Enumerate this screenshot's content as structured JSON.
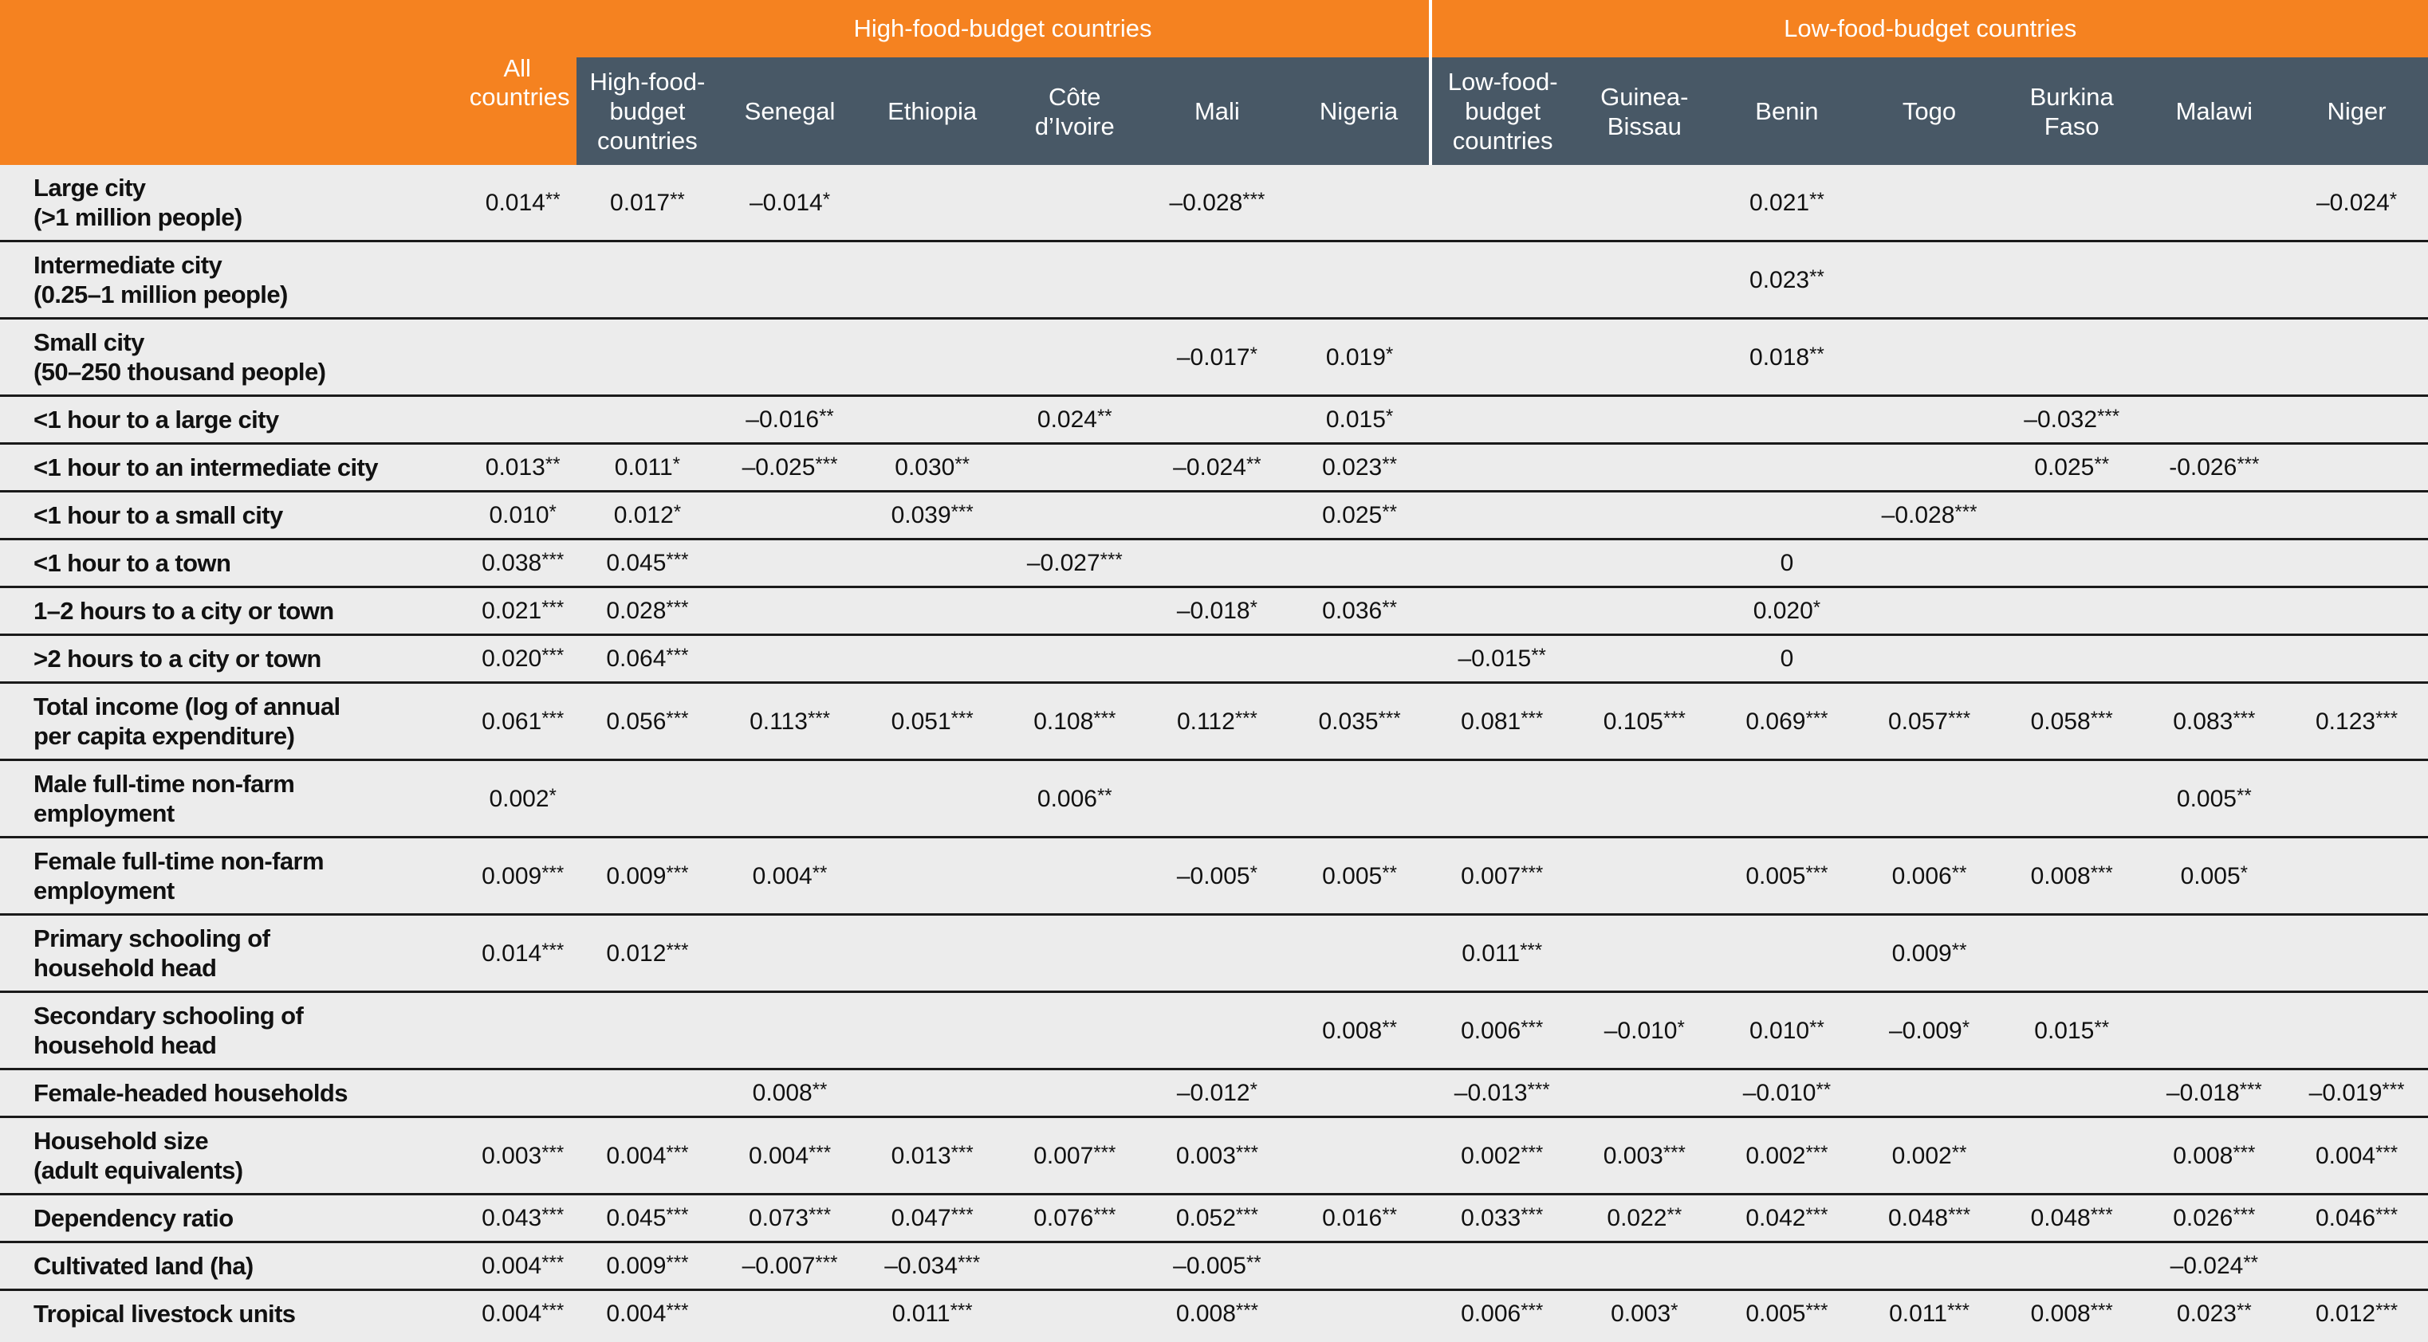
{
  "colors": {
    "orange_band": "#f58220",
    "header_dark": "#485866",
    "body_bg": "#ececec",
    "rule": "#1a1a1a"
  },
  "header": {
    "group_high": "High-food-budget countries",
    "group_low": "Low-food-budget countries",
    "all_countries": "All countries",
    "columns": [
      "High-food-budget countries",
      "Senegal",
      "Ethiopia",
      "Côte d’Ivoire",
      "Mali",
      "Nigeria",
      "Low-food-budget countries",
      "Guinea-Bissau",
      "Benin",
      "Togo",
      "Burkina Faso",
      "Malawi",
      "Niger"
    ]
  },
  "rows": [
    {
      "label": "Large city (>1 million people)",
      "label_lines": [
        "Large city",
        "(>1 million people)"
      ],
      "cells": [
        "0.014**",
        "0.017**",
        "–0.014*",
        "",
        "",
        "–0.028***",
        "",
        "",
        "",
        "0.021**",
        "",
        "",
        "",
        "–0.024*"
      ]
    },
    {
      "label": "Intermediate city (0.25–1 million people)",
      "label_lines": [
        "Intermediate city",
        "(0.25–1 million people)"
      ],
      "cells": [
        "",
        "",
        "",
        "",
        "",
        "",
        "",
        "",
        "",
        "0.023**",
        "",
        "",
        "",
        ""
      ]
    },
    {
      "label": "Small city (50–250 thousand people)",
      "label_lines": [
        "Small city",
        "(50–250 thousand people)"
      ],
      "cells": [
        "",
        "",
        "",
        "",
        "",
        "–0.017*",
        "0.019*",
        "",
        "",
        "0.018**",
        "",
        "",
        "",
        ""
      ]
    },
    {
      "label": "<1 hour to a large city",
      "label_lines": [
        "<1 hour to a large city"
      ],
      "cells": [
        "",
        "",
        "–0.016**",
        "",
        "0.024**",
        "",
        "0.015*",
        "",
        "",
        "",
        "",
        "–0.032***",
        "",
        ""
      ]
    },
    {
      "label": "<1 hour to an intermediate city",
      "label_lines": [
        "<1 hour to an intermediate city"
      ],
      "cells": [
        "0.013**",
        "0.011*",
        "–0.025***",
        "0.030**",
        "",
        "–0.024**",
        "0.023**",
        "",
        "",
        "",
        "",
        "0.025**",
        "-0.026***",
        ""
      ]
    },
    {
      "label": "<1 hour to a small city",
      "label_lines": [
        "<1 hour to a small city"
      ],
      "cells": [
        "0.010*",
        "0.012*",
        "",
        "0.039***",
        "",
        "",
        "0.025**",
        "",
        "",
        "",
        "–0.028***",
        "",
        "",
        ""
      ]
    },
    {
      "label": "<1 hour to a town",
      "label_lines": [
        "<1 hour to a town"
      ],
      "cells": [
        "0.038***",
        "0.045***",
        "",
        "",
        "–0.027***",
        "",
        "",
        "",
        "",
        "0",
        "",
        "",
        "",
        ""
      ]
    },
    {
      "label": "1–2 hours to a city or town",
      "label_lines": [
        "1–2 hours to a city or town"
      ],
      "cells": [
        "0.021***",
        "0.028***",
        "",
        "",
        "",
        "–0.018*",
        "0.036**",
        "",
        "",
        "0.020*",
        "",
        "",
        "",
        ""
      ]
    },
    {
      "label": ">2 hours to a city or town",
      "label_lines": [
        ">2 hours to a city or town"
      ],
      "cells": [
        "0.020***",
        "0.064***",
        "",
        "",
        "",
        "",
        "",
        "–0.015**",
        "",
        "0",
        "",
        "",
        "",
        ""
      ]
    },
    {
      "label": "Total income (log of annual per capita expenditure)",
      "label_lines": [
        "Total income (log of annual",
        "per capita expenditure)"
      ],
      "cells": [
        "0.061***",
        "0.056***",
        "0.113***",
        "0.051***",
        "0.108***",
        "0.112***",
        "0.035***",
        "0.081***",
        "0.105***",
        "0.069***",
        "0.057***",
        "0.058***",
        "0.083***",
        "0.123***"
      ]
    },
    {
      "label": "Male full-time non-farm employment",
      "label_lines": [
        "Male full-time non-farm",
        "employment"
      ],
      "cells": [
        "0.002*",
        "",
        "",
        "",
        "0.006**",
        "",
        "",
        "",
        "",
        "",
        "",
        "",
        "0.005**",
        ""
      ]
    },
    {
      "label": "Female full-time non-farm employment",
      "label_lines": [
        "Female full-time non-farm",
        "employment"
      ],
      "cells": [
        "0.009***",
        "0.009***",
        "0.004**",
        "",
        "",
        "–0.005*",
        "0.005**",
        "0.007***",
        "",
        "0.005***",
        "0.006**",
        "0.008***",
        "0.005*",
        ""
      ]
    },
    {
      "label": "Primary schooling of household head",
      "label_lines": [
        "Primary schooling of",
        "household head"
      ],
      "cells": [
        "0.014***",
        "0.012***",
        "",
        "",
        "",
        "",
        "",
        "0.011***",
        "",
        "",
        "0.009**",
        "",
        "",
        ""
      ]
    },
    {
      "label": "Secondary schooling of household head",
      "label_lines": [
        "Secondary schooling of",
        "household head"
      ],
      "cells": [
        "",
        "",
        "",
        "",
        "",
        "",
        "0.008**",
        "0.006***",
        "–0.010*",
        "0.010**",
        "–0.009*",
        "0.015**",
        "",
        ""
      ]
    },
    {
      "label": "Female-headed households",
      "label_lines": [
        "Female-headed households"
      ],
      "cells": [
        "",
        "",
        "0.008**",
        "",
        "",
        "–0.012*",
        "",
        "–0.013***",
        "",
        "–0.010**",
        "",
        "",
        "–0.018***",
        "–0.019***"
      ]
    },
    {
      "label": "Household size (adult equivalents)",
      "label_lines": [
        "Household size",
        "(adult equivalents)"
      ],
      "cells": [
        "0.003***",
        "0.004***",
        "0.004***",
        "0.013***",
        "0.007***",
        "0.003***",
        "",
        "0.002***",
        "0.003***",
        "0.002***",
        "0.002**",
        "",
        "0.008***",
        "0.004***"
      ]
    },
    {
      "label": "Dependency ratio",
      "label_lines": [
        "Dependency ratio"
      ],
      "cells": [
        "0.043***",
        "0.045***",
        "0.073***",
        "0.047***",
        "0.076***",
        "0.052***",
        "0.016**",
        "0.033***",
        "0.022**",
        "0.042***",
        "0.048***",
        "0.048***",
        "0.026***",
        "0.046***"
      ]
    },
    {
      "label": "Cultivated land (ha)",
      "label_lines": [
        "Cultivated land (ha)"
      ],
      "cells": [
        "0.004***",
        "0.009***",
        "–0.007***",
        "–0.034***",
        "",
        "–0.005**",
        "",
        "",
        "",
        "",
        "",
        "",
        "–0.024**",
        ""
      ]
    },
    {
      "label": "Tropical livestock units",
      "label_lines": [
        "Tropical livestock units"
      ],
      "cells": [
        "0.004***",
        "0.004***",
        "",
        "0.011***",
        "",
        "0.008***",
        "",
        "0.006***",
        "0.003*",
        "0.005***",
        "0.011***",
        "0.008***",
        "0.023**",
        "0.012***"
      ]
    }
  ]
}
